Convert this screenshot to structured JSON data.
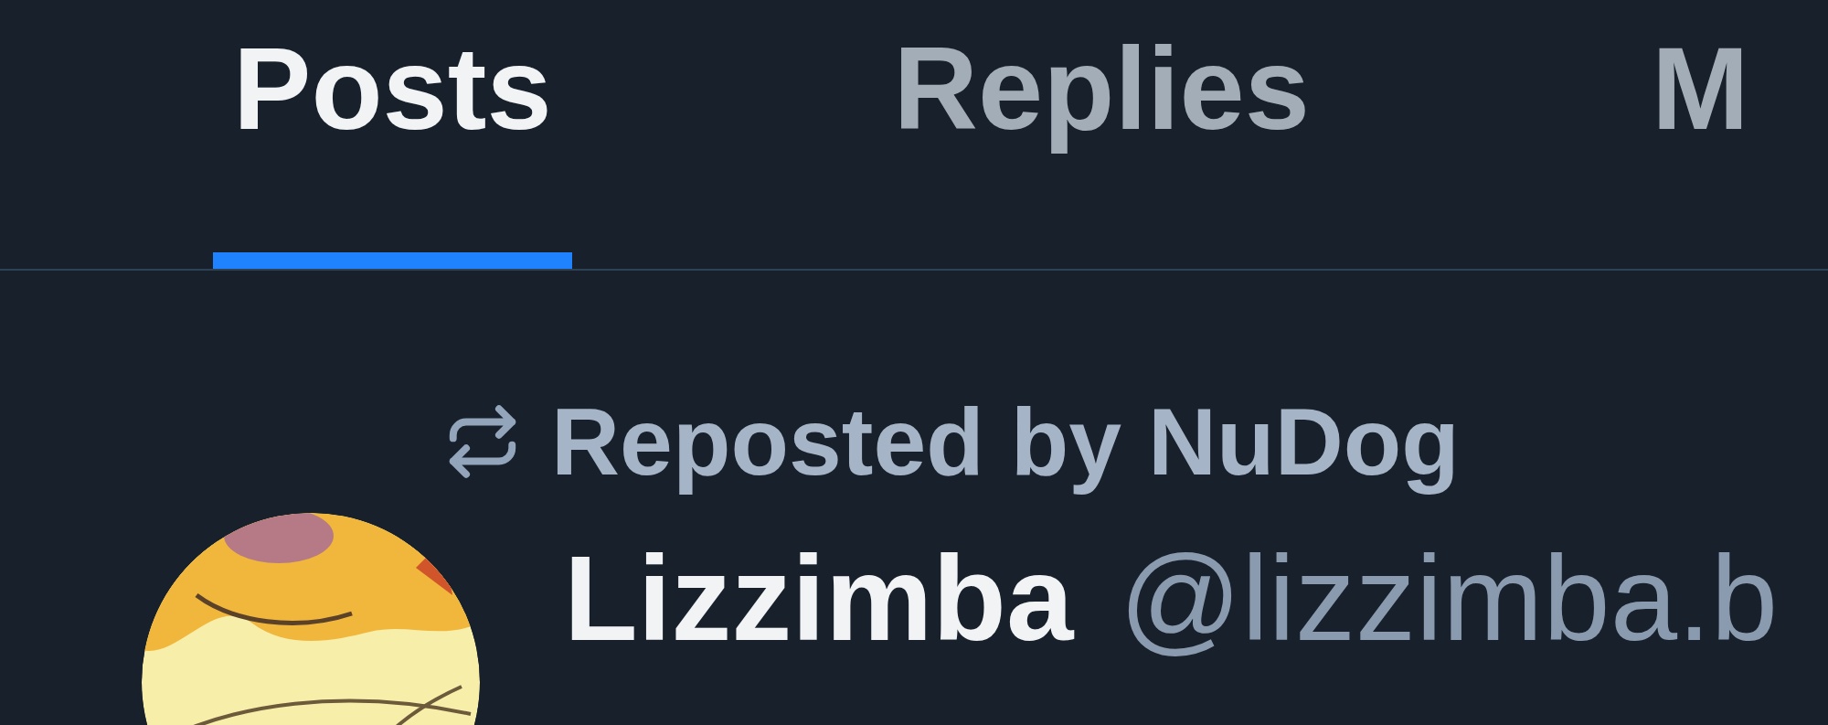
{
  "tabs": [
    {
      "label": "Posts",
      "selected": true
    },
    {
      "label": "Replies",
      "selected": false
    },
    {
      "label": "M",
      "selected": false
    }
  ],
  "post": {
    "reposted_by": "Reposted by NuDog",
    "author": {
      "name": "Lizzimba",
      "handle": "@lizzimba.b"
    }
  }
}
